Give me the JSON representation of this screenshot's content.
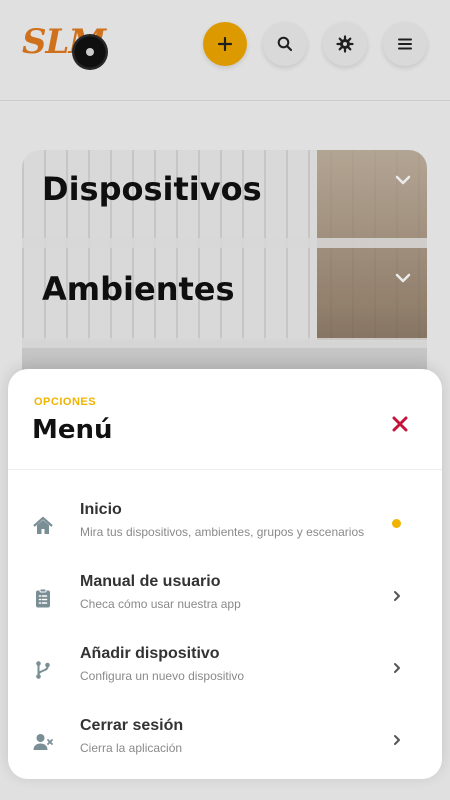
{
  "logo": {
    "text": "SLM",
    "name": "slm-logo"
  },
  "toolbar": {
    "buttons": [
      {
        "name": "add-button",
        "icon": "plus-icon"
      },
      {
        "name": "search-button",
        "icon": "search-icon"
      },
      {
        "name": "settings-button",
        "icon": "gear-icon"
      },
      {
        "name": "menu-button",
        "icon": "hamburger-icon"
      }
    ],
    "accent": "#f0a800"
  },
  "cards": [
    {
      "title": "Dispositivos"
    },
    {
      "title": "Ambientes"
    }
  ],
  "sheet": {
    "kicker": "OPCIONES",
    "title": "Menú",
    "close_icon": "close-icon",
    "accent": "#f0b400",
    "close_color": "#c4143c",
    "items": [
      {
        "title": "Inicio",
        "subtitle": "Mira tus dispositivos, ambientes, grupos y escenarios",
        "icon": "home-icon",
        "indicator": "active-dot"
      },
      {
        "title": "Manual de usuario",
        "subtitle": "Checa cómo usar nuestra app",
        "icon": "clipboard-icon",
        "indicator": "chevron"
      },
      {
        "title": "Añadir dispositivo",
        "subtitle": "Configura un nuevo dispositivo",
        "icon": "fork-icon",
        "indicator": "chevron"
      },
      {
        "title": "Cerrar sesión",
        "subtitle": "Cierra la aplicación",
        "icon": "user-remove-icon",
        "indicator": "chevron"
      }
    ]
  }
}
